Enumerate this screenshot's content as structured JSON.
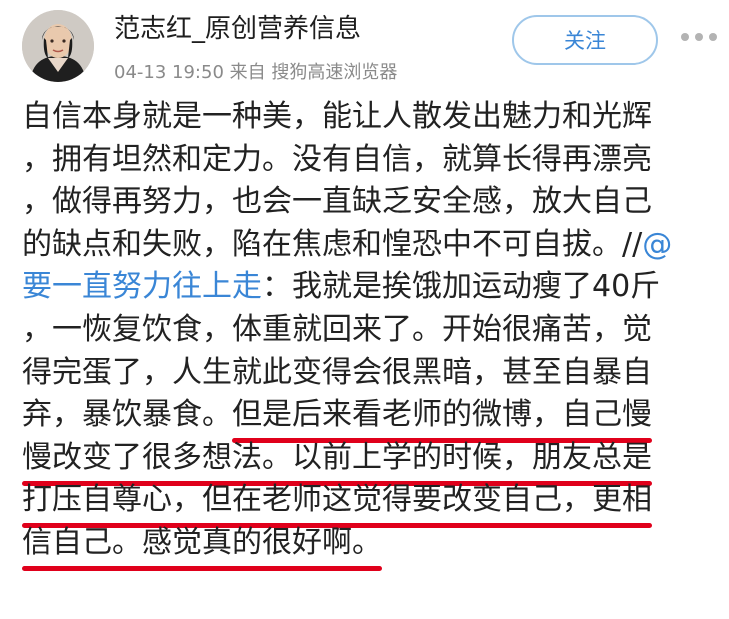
{
  "header": {
    "username": "范志红_原创营养信息",
    "meta": "04-13 19:50 来自 搜狗高速浏览器",
    "follow_label": "关注"
  },
  "post": {
    "l1": "自信本身就是一种美，能让人散发出魅力和光辉",
    "l2": "，拥有坦然和定力。没有自信，就算长得再漂亮",
    "l3": "，做得再努力，也会一直缺乏安全感，放大自己",
    "l4_a": "的缺点和失败，陷在焦虑和惶恐中不可自拔。//",
    "l4_mention": "@",
    "l5_mention": "要一直努力往上走",
    "l5_b": "：我就是挨饿加运动瘦了40斤",
    "l6": "，一恢复饮食，体重就回来了。开始很痛苦，觉",
    "l7": "得完蛋了，人生就此变得会很黑暗，甚至自暴自",
    "l8_a": "弃，暴饮暴食。",
    "l8_b": "但是后来看老师的微博，自己慢",
    "l9": "慢改变了很多想法。以前上学的时候，朋友总是",
    "l10": "打压自尊心，但在老师这觉得要改变自己，更相",
    "l11": "信自己。感觉真的很好啊。"
  }
}
